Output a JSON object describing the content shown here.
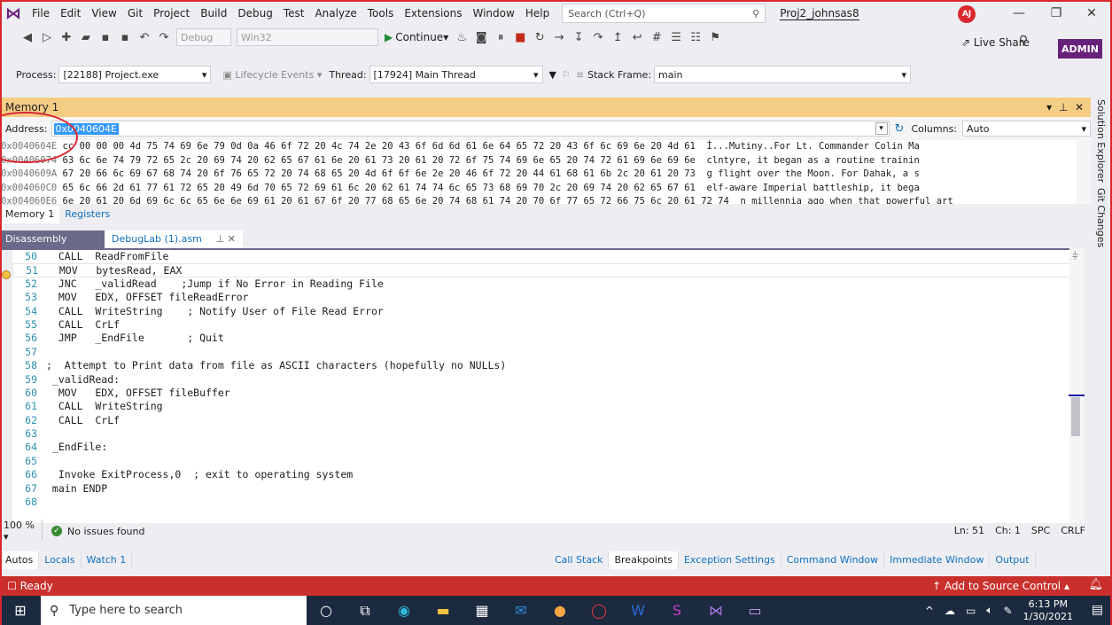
{
  "menu": {
    "items": [
      "File",
      "Edit",
      "View",
      "Git",
      "Project",
      "Build",
      "Debug",
      "Test",
      "Analyze",
      "Tools",
      "Extensions",
      "Window",
      "Help"
    ],
    "search_placeholder": "Search (Ctrl+Q)",
    "project_name": "Proj2_johnsas8",
    "avatar_initials": "AJ"
  },
  "toolbar": {
    "config": "Debug",
    "platform": "Win32",
    "continue_label": "Continue",
    "live_share": "Live Share",
    "admin_badge": "ADMIN"
  },
  "location": {
    "process_label": "Process:",
    "process_value": "[22188] Project.exe",
    "lifecycle": "Lifecycle Events",
    "thread_label": "Thread:",
    "thread_value": "[17924] Main Thread",
    "stack_label": "Stack Frame:",
    "stack_value": "main"
  },
  "memory": {
    "title": "Memory 1",
    "address_label": "Address:",
    "address_value": "0x0040604E",
    "columns_label": "Columns:",
    "columns_value": "Auto",
    "rows": [
      {
        "addr": "0x0040604E",
        "hex": "cc 00 00 00 4d 75 74 69 6e 79 0d 0a 46 6f 72 20 4c 74 2e 20 43 6f 6d 6d 61 6e 64 65 72 20 43 6f 6c 69 6e 20 4d 61",
        "text": "Ì...Mutiny..For Lt. Commander Colin Ma"
      },
      {
        "addr": "0x00406074",
        "hex": "63 6c 6e 74 79 72 65 2c 20 69 74 20 62 65 67 61 6e 20 61 73 20 61 20 72 6f 75 74 69 6e 65 20 74 72 61 69 6e 69 6e",
        "text": "clntyre, it began as a routine trainin"
      },
      {
        "addr": "0x0040609A",
        "hex": "67 20 66 6c 69 67 68 74 20 6f 76 65 72 20 74 68 65 20 4d 6f 6f 6e 2e 20 46 6f 72 20 44 61 68 61 6b 2c 20 61 20 73",
        "text": "g flight over the Moon. For Dahak, a s"
      },
      {
        "addr": "0x004060C0",
        "hex": "65 6c 66 2d 61 77 61 72 65 20 49 6d 70 65 72 69 61 6c 20 62 61 74 74 6c 65 73 68 69 70 2c 20 69 74 20 62 65 67 61",
        "text": "elf-aware Imperial battleship, it bega"
      },
      {
        "addr": "0x004060E6",
        "hex": "6e 20 61 20 6d 69 6c 6c 65 6e 6e 69 61 20 61 67 6f 20 77 68 65 6e 20 74 68 61 74 20 70 6f 77 65 72 66 75 6c 20 61 72 74",
        "text": "n millennia ago when that powerful art"
      }
    ],
    "tabs": [
      "Memory 1",
      "Registers"
    ]
  },
  "side_panels": [
    "Solution Explorer",
    "Git Changes"
  ],
  "editor": {
    "tabs": {
      "disassembly": "Disassembly",
      "file": "DebugLab (1).asm"
    },
    "lines": [
      {
        "n": "50",
        "code": "  CALL  ReadFromFile"
      },
      {
        "n": "51",
        "code": "  MOV   bytesRead, EAX"
      },
      {
        "n": "52",
        "code": "  JNC   _validRead    ;Jump if No Error in Reading File"
      },
      {
        "n": "53",
        "code": "  MOV   EDX, OFFSET fileReadError"
      },
      {
        "n": "54",
        "code": "  CALL  WriteString    ; Notify User of File Read Error"
      },
      {
        "n": "55",
        "code": "  CALL  CrLf"
      },
      {
        "n": "56",
        "code": "  JMP   _EndFile       ; Quit"
      },
      {
        "n": "57",
        "code": ""
      },
      {
        "n": "58",
        "code": ";  Attempt to Print data from file as ASCII characters (hopefully no NULLs)"
      },
      {
        "n": "59",
        "code": " _validRead:"
      },
      {
        "n": "60",
        "code": "  MOV   EDX, OFFSET fileBuffer"
      },
      {
        "n": "61",
        "code": "  CALL  WriteString"
      },
      {
        "n": "62",
        "code": "  CALL  CrLf"
      },
      {
        "n": "63",
        "code": ""
      },
      {
        "n": "64",
        "code": " _EndFile:"
      },
      {
        "n": "65",
        "code": ""
      },
      {
        "n": "66",
        "code": "  Invoke ExitProcess,0  ; exit to operating system"
      },
      {
        "n": "67",
        "code": " main ENDP"
      },
      {
        "n": "68",
        "code": ""
      }
    ],
    "zoom": "100 %",
    "issues": "No issues found",
    "ln": "Ln: 51",
    "ch": "Ch: 1",
    "spc": "SPC",
    "crlf": "CRLF"
  },
  "bottom_tabs_left": [
    "Autos",
    "Locals",
    "Watch 1"
  ],
  "bottom_tabs_right": [
    "Call Stack",
    "Breakpoints",
    "Exception Settings",
    "Command Window",
    "Immediate Window",
    "Output"
  ],
  "status": {
    "ready": "Ready",
    "source_control": "Add to Source Control"
  },
  "taskbar": {
    "search_placeholder": "Type here to search",
    "time": "6:13 PM",
    "date": "1/30/2021"
  },
  "colors": {
    "status_bar": "#c9302c",
    "memory_title": "#f5cc84",
    "admin_badge": "#68217a",
    "taskbar": "#1c2a3f"
  }
}
